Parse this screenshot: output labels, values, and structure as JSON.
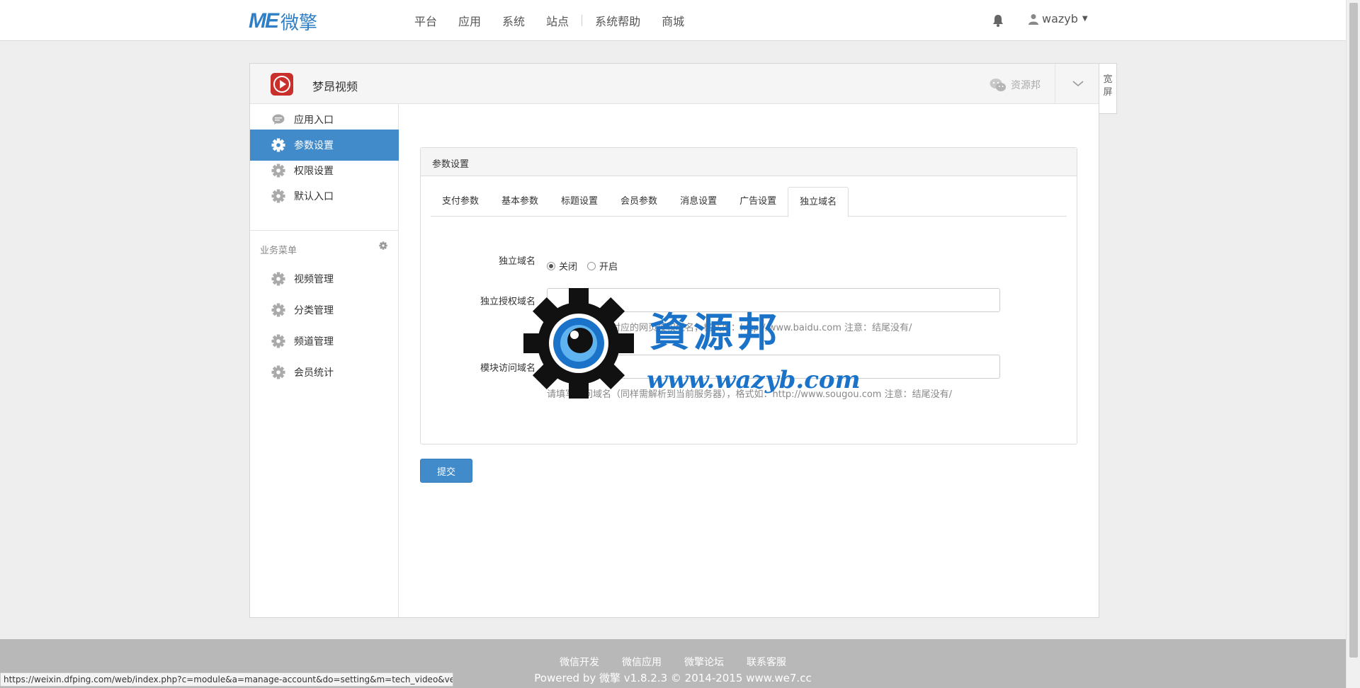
{
  "brand": {
    "logo_mark": "ME",
    "logo_text": "微擎"
  },
  "nav": {
    "items": [
      "平台",
      "应用",
      "系统",
      "站点",
      "系统帮助",
      "商城"
    ]
  },
  "user": {
    "name": "wazyb"
  },
  "app": {
    "name": "梦昂视频",
    "account_name": "资源邦",
    "wide_label": "宽屏"
  },
  "sidebar": {
    "items": [
      {
        "label": "应用入口",
        "icon": "chat-bubble-icon"
      },
      {
        "label": "参数设置",
        "icon": "gear-icon",
        "active": true
      },
      {
        "label": "权限设置",
        "icon": "gear-icon"
      },
      {
        "label": "默认入口",
        "icon": "gear-icon"
      }
    ],
    "section_label": "业务菜单",
    "biz_items": [
      {
        "label": "视频管理",
        "icon": "gear-icon"
      },
      {
        "label": "分类管理",
        "icon": "gear-icon"
      },
      {
        "label": "频道管理",
        "icon": "gear-icon"
      },
      {
        "label": "会员统计",
        "icon": "gear-icon"
      }
    ]
  },
  "settings": {
    "title": "参数设置",
    "tabs": [
      "支付参数",
      "基本参数",
      "标题设置",
      "会员参数",
      "消息设置",
      "广告设置",
      "独立域名"
    ],
    "active_tab": "独立域名",
    "form": {
      "domain_switch_label": "独立域名",
      "radio_off": "关闭",
      "radio_on": "开启",
      "selected": "关闭",
      "auth_domain_label": "独立授权域名",
      "auth_domain_value": "",
      "auth_domain_help": "请填写公众平台对应的网页授权域名，格式如：http://www.baidu.com 注意：结尾没有/",
      "module_domain_label": "模块访问域名",
      "module_domain_value": "",
      "module_domain_help": "请填写访问域名（同样需解析到当前服务器），格式如：http://www.sougou.com 注意：结尾没有/"
    },
    "submit_label": "提交"
  },
  "watermark": {
    "cn": "資源邦",
    "url": "www.wazyb.com"
  },
  "footer": {
    "links": [
      "微信开发",
      "微信应用",
      "微擎论坛",
      "联系客服"
    ],
    "copyright": "Powered by 微擎 v1.8.2.3 © 2014-2015 www.we7.cc"
  },
  "status_bar_url": "https://weixin.dfping.com/web/index.php?c=module&a=manage-account&do=setting&m=tech_video&ver...",
  "colors": {
    "accent": "#428bca",
    "brand": "#2e7fc6",
    "app_icon": "#c9302c"
  }
}
